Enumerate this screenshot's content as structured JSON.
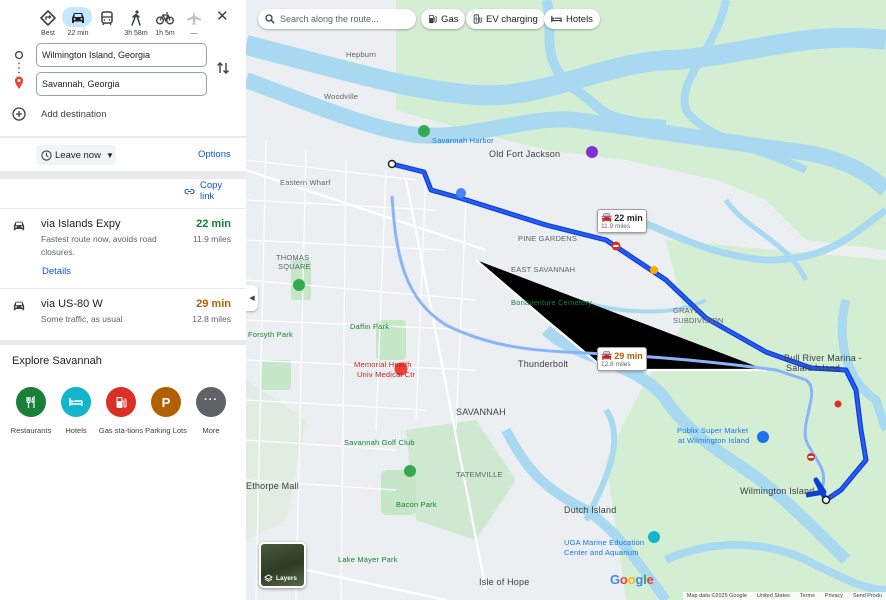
{
  "modes": [
    {
      "icon": "best-route-icon",
      "label": "Best"
    },
    {
      "icon": "car-icon",
      "label": "22 min"
    },
    {
      "icon": "transit-icon",
      "label": ""
    },
    {
      "icon": "walk-icon",
      "label": "3h 58m"
    },
    {
      "icon": "bike-icon",
      "label": "1h 5m"
    },
    {
      "icon": "flight-icon",
      "label": "—"
    }
  ],
  "origin": "Wilmington Island, Georgia",
  "destination": "Savannah, Georgia",
  "add_destination": "Add destination",
  "leave_now": "Leave now",
  "options": "Options",
  "copy_link": "Copy link",
  "routes": [
    {
      "title": "via Islands Expy",
      "desc": "Fastest route now, avoids road closures.",
      "time": "22 min",
      "distance": "11.9 miles",
      "details": "Details",
      "time_color": "#188038"
    },
    {
      "title": "via US-80 W",
      "desc": "Some traffic, as usual",
      "time": "29 min",
      "distance": "12.8 miles",
      "time_color": "#b06000"
    }
  ],
  "explore": {
    "title": "Explore Savannah",
    "items": [
      {
        "label": "Restaurants",
        "icon": "restaurant-icon",
        "color": "#188038"
      },
      {
        "label": "Hotels",
        "icon": "hotel-icon",
        "color": "#12b5cb"
      },
      {
        "label": "Gas sta-tions",
        "icon": "gas-station-icon",
        "color": "#d93025"
      },
      {
        "label": "Parking Lots",
        "icon": "parking-icon",
        "color": "#b06000"
      },
      {
        "label": "More",
        "icon": "more-icon",
        "color": "#5f6368"
      }
    ]
  },
  "map": {
    "search_placeholder": "Search along the route...",
    "chips": [
      "Gas",
      "EV charging",
      "Hotels"
    ],
    "callouts": [
      {
        "time": "22 min",
        "distance": "11.9 miles"
      },
      {
        "time": "29 min",
        "distance": "12.8 miles"
      }
    ],
    "labels": [
      {
        "text": "Savannah Harbor"
      },
      {
        "text": "Old Fort Jackson"
      },
      {
        "text": "PINE GARDENS"
      },
      {
        "text": "EAST SAVANNAH"
      },
      {
        "text": "Bonaventure Cemetery"
      },
      {
        "text": "GRAYS"
      },
      {
        "text": "SUBDIVISION"
      },
      {
        "text": "Bull River Marina -"
      },
      {
        "text": "Salahi Island"
      },
      {
        "text": "Thunderbolt"
      },
      {
        "text": "Memorial Health"
      },
      {
        "text": "Univ Medical Ctr"
      },
      {
        "text": "SAVANNAH"
      },
      {
        "text": "Publix Super Market"
      },
      {
        "text": "at Wilmington Island"
      },
      {
        "text": "Wilmington Island"
      },
      {
        "text": "Dutch Island"
      },
      {
        "text": "UGA Marine Education"
      },
      {
        "text": "Center and Aquarium"
      },
      {
        "text": "Isle of Hope"
      },
      {
        "text": "Lake Mayer Park"
      },
      {
        "text": "Hepburn"
      },
      {
        "text": "Woodville"
      },
      {
        "text": "TATEMVILLE"
      },
      {
        "text": "THOMAS"
      },
      {
        "text": "SQUARE"
      },
      {
        "text": "Eastern Wharf"
      },
      {
        "text": "Forsyth Park"
      },
      {
        "text": "Bacon Park"
      },
      {
        "text": "Savannah Golf Club"
      },
      {
        "text": "Daffin Park"
      },
      {
        "text": "Ethorpe Mall"
      }
    ],
    "layers": "Layers",
    "footer": [
      "Map data ©2025 Google",
      "United States",
      "Terms",
      "Privacy",
      "Send Produ"
    ]
  }
}
